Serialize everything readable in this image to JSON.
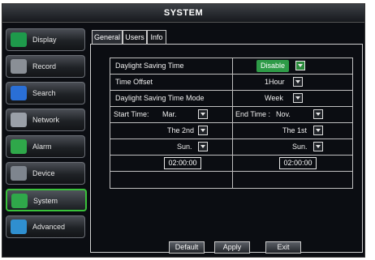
{
  "title": "SYSTEM",
  "sidebar": {
    "items": [
      {
        "label": "Display",
        "icon": "display-icon",
        "color": "#1e9a4b"
      },
      {
        "label": "Record",
        "icon": "record-icon",
        "color": "#8a8f96"
      },
      {
        "label": "Search",
        "icon": "search-icon",
        "color": "#2a6fd6"
      },
      {
        "label": "Network",
        "icon": "network-icon",
        "color": "#9aa0a8"
      },
      {
        "label": "Alarm",
        "icon": "alarm-icon",
        "color": "#2fa84a"
      },
      {
        "label": "Device",
        "icon": "device-icon",
        "color": "#7e858e"
      },
      {
        "label": "System",
        "icon": "system-icon",
        "color": "#2fa84a"
      },
      {
        "label": "Advanced",
        "icon": "advanced-icon",
        "color": "#2f8fd0"
      }
    ],
    "active": "System"
  },
  "tabs": [
    {
      "label": "General"
    },
    {
      "label": "Users"
    },
    {
      "label": "Info"
    }
  ],
  "form": {
    "dst_label": "Daylight Saving Time",
    "dst_value": "Disable",
    "offset_label": "Time Offset",
    "offset_value": "1Hour",
    "mode_label": "Daylight Saving Time Mode",
    "mode_value": "Week",
    "start_label": "Start Time:",
    "start_month": "Mar.",
    "end_label": "End Time :",
    "end_month": "Nov.",
    "start_week": "The 2nd",
    "end_week": "The 1st",
    "start_day": "Sun.",
    "end_day": "Sun.",
    "start_time": "02:00:00",
    "end_time": "02:00:00"
  },
  "buttons": {
    "default": "Default",
    "apply": "Apply",
    "exit": "Exit"
  },
  "colors": {
    "accent_green": "#2fa84a",
    "background": "#0b0d12"
  }
}
